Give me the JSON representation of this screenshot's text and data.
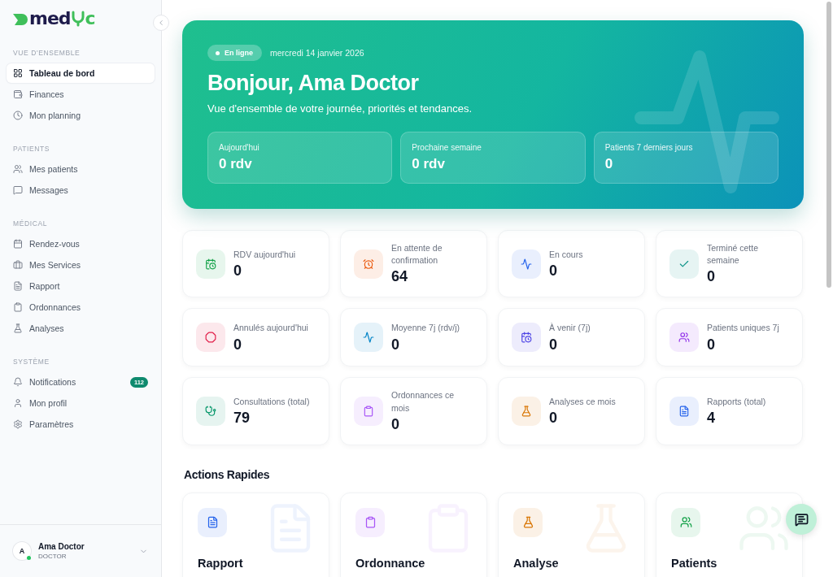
{
  "logo": {
    "prefix": "med",
    "suffix": "c"
  },
  "sidebar": {
    "sections": [
      {
        "title": "VUE D'ENSEMBLE",
        "items": [
          {
            "label": "Tableau de bord",
            "kind": "grid",
            "selected": true
          },
          {
            "label": "Finances",
            "kind": "wallet",
            "selected": false
          },
          {
            "label": "Mon planning",
            "kind": "clock",
            "selected": false
          }
        ]
      },
      {
        "title": "PATIENTS",
        "items": [
          {
            "label": "Mes patients",
            "kind": "users",
            "selected": false
          },
          {
            "label": "Messages",
            "kind": "message",
            "selected": false
          }
        ]
      },
      {
        "title": "MÉDICAL",
        "items": [
          {
            "label": "Rendez-vous",
            "kind": "calendar",
            "selected": false
          },
          {
            "label": "Mes Services",
            "kind": "briefcase",
            "selected": false
          },
          {
            "label": "Rapport",
            "kind": "file",
            "selected": false
          },
          {
            "label": "Ordonnances",
            "kind": "clipboard",
            "selected": false
          },
          {
            "label": "Analyses",
            "kind": "flask",
            "selected": false
          }
        ]
      },
      {
        "title": "SYSTÈME",
        "items": [
          {
            "label": "Notifications",
            "kind": "bell",
            "selected": false,
            "badge": "112"
          },
          {
            "label": "Mon profil",
            "kind": "user",
            "selected": false
          },
          {
            "label": "Paramètres",
            "kind": "gear",
            "selected": false
          }
        ]
      }
    ],
    "user": {
      "initial": "A",
      "name": "Ama Doctor",
      "role": "DOCTOR",
      "online": true
    }
  },
  "hero": {
    "status": "En ligne",
    "date": "mercredi 14 janvier 2026",
    "title": "Bonjour, Ama Doctor",
    "subtitle": "Vue d'ensemble de votre journée, priorités et tendances.",
    "summaries": [
      {
        "label": "Aujourd'hui",
        "value": "0 rdv"
      },
      {
        "label": "Prochaine semaine",
        "value": "0 rdv"
      },
      {
        "label": "Patients 7 derniers jours",
        "value": "0"
      }
    ]
  },
  "stats": [
    {
      "label": "RDV aujourd'hui",
      "value": "0",
      "kind": "calendar-clock",
      "color": "#16a34a"
    },
    {
      "label": "En attente de confirmation",
      "value": "64",
      "kind": "alarm",
      "color": "#ea580c"
    },
    {
      "label": "En cours",
      "value": "0",
      "kind": "activity",
      "color": "#2563eb"
    },
    {
      "label": "Terminé cette semaine",
      "value": "0",
      "kind": "check",
      "color": "#0d9488"
    },
    {
      "label": "Annulés aujourd'hui",
      "value": "0",
      "kind": "octagon",
      "color": "#e11d48"
    },
    {
      "label": "Moyenne 7j (rdv/j)",
      "value": "0",
      "kind": "activity",
      "color": "#0284c7"
    },
    {
      "label": "À venir (7j)",
      "value": "0",
      "kind": "calendar-clock",
      "color": "#4f46e5"
    },
    {
      "label": "Patients uniques 7j",
      "value": "0",
      "kind": "users",
      "color": "#9333ea"
    },
    {
      "label": "Consultations (total)",
      "value": "79",
      "kind": "stethoscope",
      "color": "#059669"
    },
    {
      "label": "Ordonnances ce mois",
      "value": "0",
      "kind": "clipboard",
      "color": "#a855f7"
    },
    {
      "label": "Analyses ce mois",
      "value": "0",
      "kind": "flask",
      "color": "#d97706"
    },
    {
      "label": "Rapports (total)",
      "value": "4",
      "kind": "file",
      "color": "#2563eb"
    }
  ],
  "actions": {
    "title": "Actions Rapides",
    "items": [
      {
        "title": "Rapport",
        "kind": "file",
        "color": "#2563eb"
      },
      {
        "title": "Ordonnance",
        "kind": "clipboard",
        "color": "#a855f7"
      },
      {
        "title": "Analyse",
        "kind": "flask",
        "color": "#d97706"
      },
      {
        "title": "Patients",
        "kind": "users",
        "color": "#16a34a"
      }
    ]
  }
}
